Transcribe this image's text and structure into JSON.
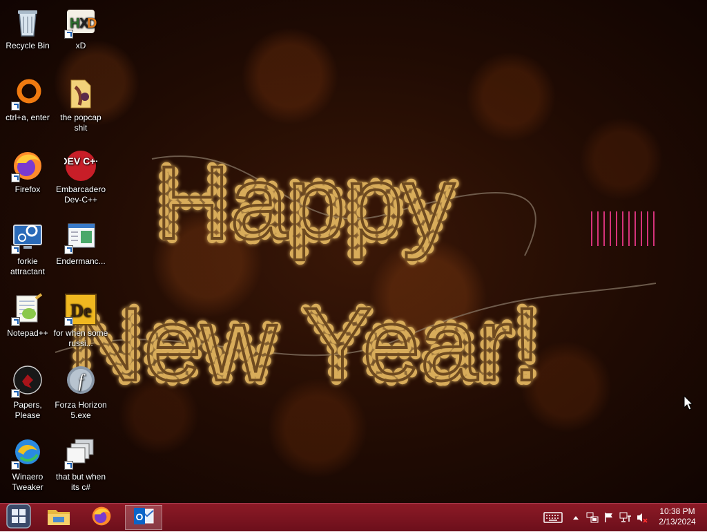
{
  "desktop": {
    "icons": [
      {
        "label": "Recycle Bin",
        "icon": "recycle-bin-icon"
      },
      {
        "label": "xD",
        "icon": "hxd-icon"
      },
      {
        "label": "ctrl+a, enter",
        "icon": "ring-icon"
      },
      {
        "label": "the popcap shit",
        "icon": "folder-icon"
      },
      {
        "label": "Firefox",
        "icon": "firefox-icon"
      },
      {
        "label": "Embarcadero Dev-C++",
        "icon": "devcpp-icon",
        "badge": "DEV C++"
      },
      {
        "label": "forkie attractant",
        "icon": "settings-monitor-icon"
      },
      {
        "label": "Endermanc...",
        "icon": "window-app-icon"
      },
      {
        "label": "Notepad++",
        "icon": "notepad-plus-plus-icon"
      },
      {
        "label": "for when some russi...",
        "icon": "de-app-icon",
        "badge": "De"
      },
      {
        "label": "Papers, Please",
        "icon": "papers-please-icon"
      },
      {
        "label": "Forza Horizon 5.exe",
        "icon": "flash-icon"
      },
      {
        "label": "Winaero Tweaker",
        "icon": "winaero-icon"
      },
      {
        "label": "that but when its c#",
        "icon": "stacked-windows-icon"
      }
    ]
  },
  "wallpaper": {
    "line1": "Happy",
    "line2": "New Year!",
    "colors": {
      "bulb": "#fff1b8",
      "tube": "#c9a058",
      "glow": "#e8b04a",
      "bokeh": "#3a1707"
    }
  },
  "taskbar": {
    "color": "#7a1320",
    "buttons": [
      {
        "name": "start-button",
        "icon": "windows-logo-icon"
      },
      {
        "name": "file-explorer-button",
        "icon": "file-explorer-icon"
      },
      {
        "name": "firefox-taskbar-button",
        "icon": "firefox-icon"
      },
      {
        "name": "outlook-taskbar-button",
        "icon": "outlook-icon",
        "active": true
      }
    ],
    "tray": [
      "keyboard-icon",
      "chevron-up-icon",
      "network-status-icon",
      "action-center-flag-icon",
      "ethernet-icon",
      "speaker-muted-icon"
    ],
    "clock": {
      "time": "10:38 PM",
      "date": "2/13/2024"
    }
  }
}
